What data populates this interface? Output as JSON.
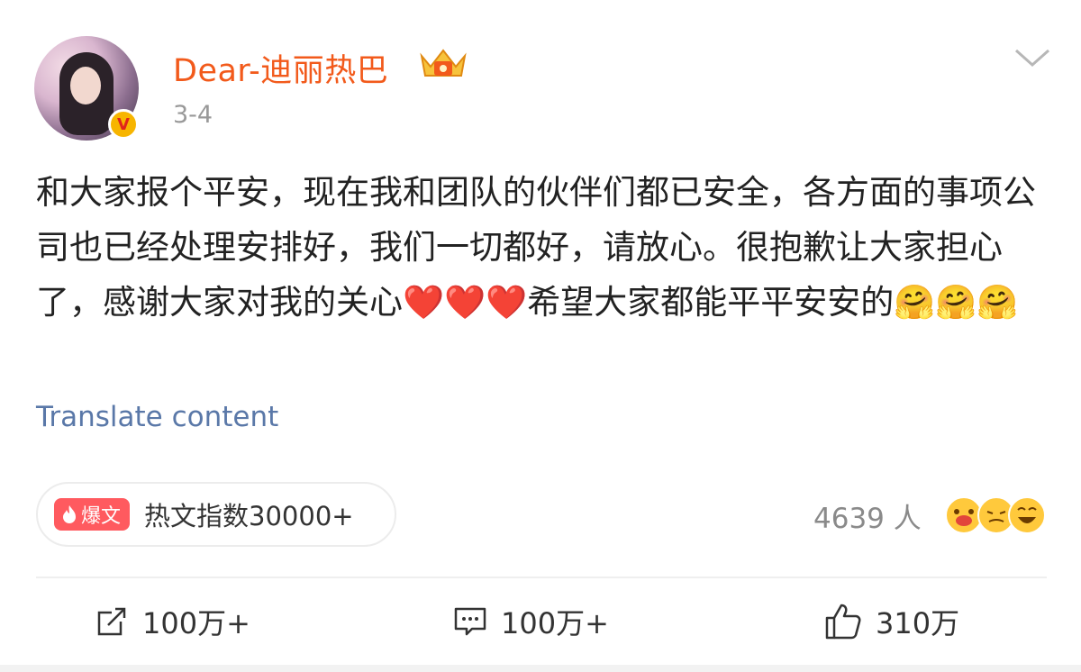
{
  "post": {
    "username": "Dear-迪丽热巴",
    "date": "3-4",
    "verified_mark": "V",
    "content": "和大家报个平安，现在我和团队的伙伴们都已安全，各方面的事项公司也已经处理安排好，我们一切都好，请放心。很抱歉让大家担心了，感谢大家对我的关心❤️❤️❤️希望大家都能平平安安的🤗🤗🤗",
    "translate_label": "Translate content"
  },
  "hot": {
    "badge_label": "爆文",
    "text": "热文指数30000+"
  },
  "reactions": {
    "count": "4639 人"
  },
  "actions": {
    "repost": "100万+",
    "comment": "100万+",
    "like": "310万"
  },
  "colors": {
    "username": "#f25a1b",
    "link": "#5a78a8",
    "badge": "#ff5a5f"
  },
  "icons": [
    "crown-icon",
    "chevron-down-icon",
    "fire-icon",
    "repost-icon",
    "comment-icon",
    "like-icon"
  ]
}
